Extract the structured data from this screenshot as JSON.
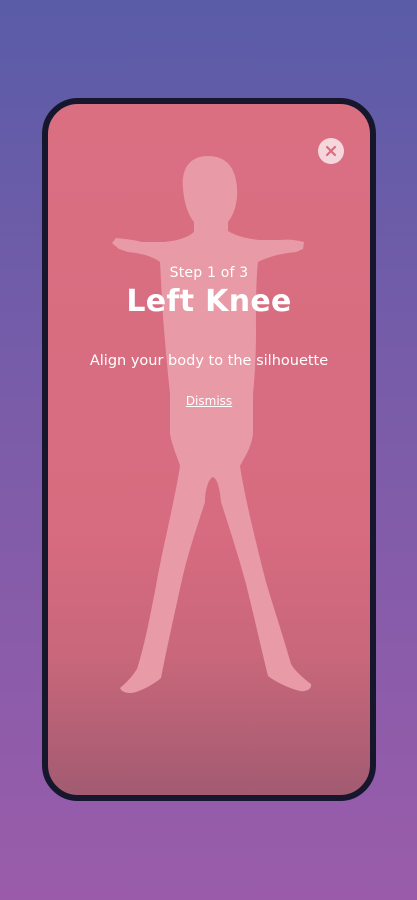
{
  "overlay": {
    "step": "Step 1 of 3",
    "title": "Left Knee",
    "instruction": "Align your body to the silhouette",
    "dismiss_label": "Dismiss"
  },
  "icons": {
    "close": "close-icon",
    "silhouette": "body-silhouette"
  },
  "colors": {
    "background_top": "#5a5ca8",
    "background_bottom": "#9a5caa",
    "screen": "#d96d80",
    "bezel": "#16172d"
  }
}
